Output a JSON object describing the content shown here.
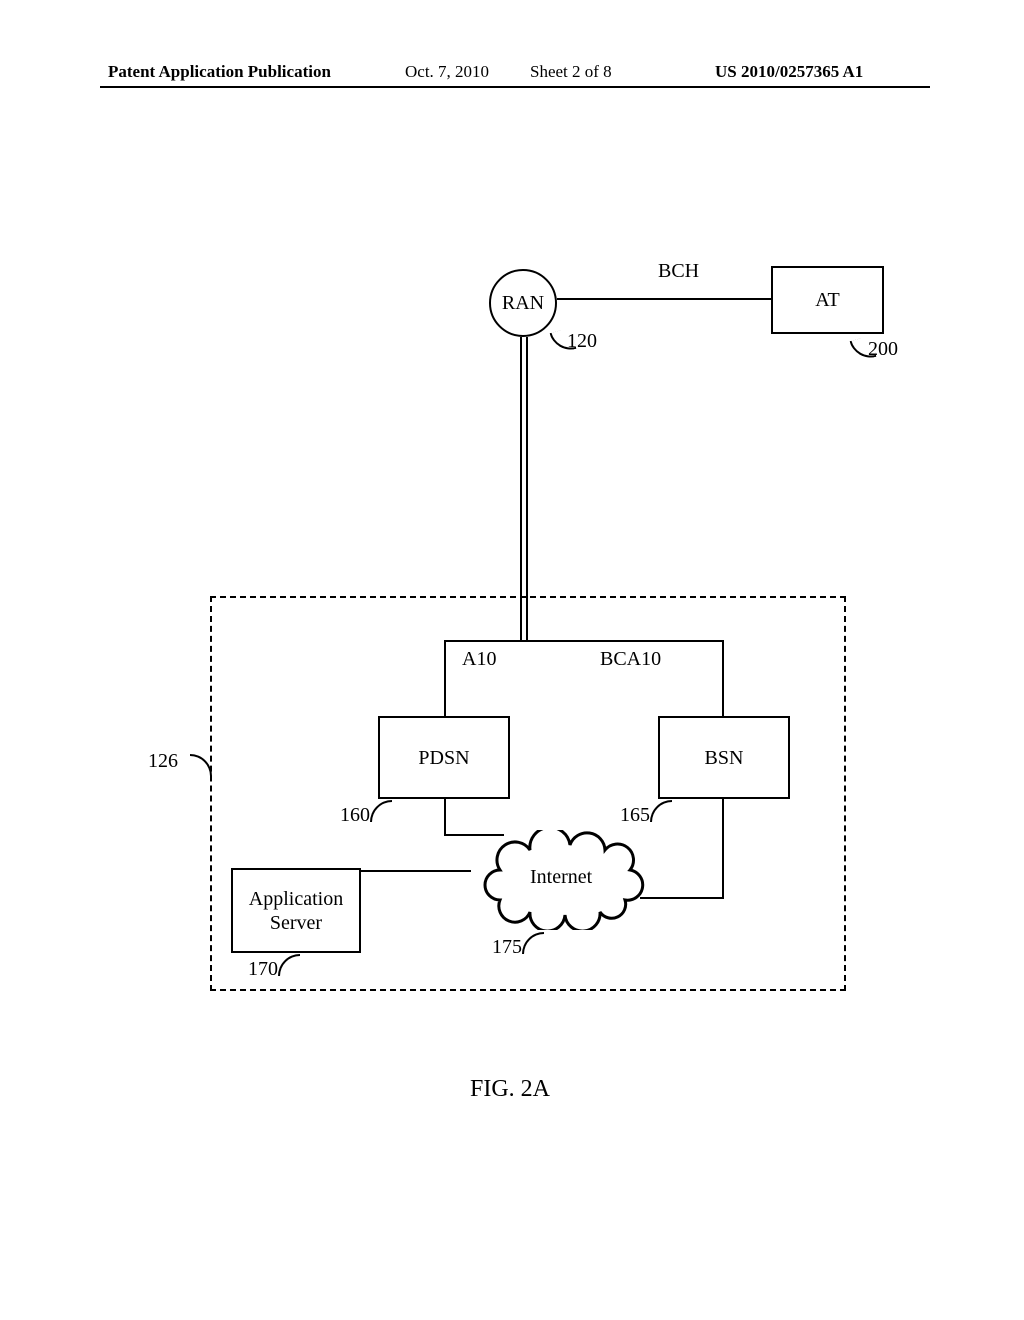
{
  "header": {
    "left": "Patent Application Publication",
    "date": "Oct. 7, 2010",
    "sheet": "Sheet 2 of 8",
    "pubno": "US 2010/0257365 A1"
  },
  "figure_label": "FIG. 2A",
  "nodes": {
    "ran": "RAN",
    "at": "AT",
    "pdsn": "PDSN",
    "bsn": "BSN",
    "appserver": "Application\nServer",
    "internet": "Internet"
  },
  "link_labels": {
    "bch": "BCH",
    "a10": "A10",
    "bca10": "BCA10"
  },
  "refs": {
    "ran": "120",
    "at": "200",
    "carrier_box": "126",
    "pdsn": "160",
    "bsn": "165",
    "appserver": "170",
    "internet": "175"
  }
}
